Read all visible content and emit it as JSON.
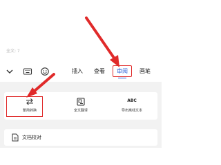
{
  "document": {
    "word_count": "全文: 7"
  },
  "toolbar": {
    "icons": [
      "chevron-down-icon",
      "keyboard-icon",
      "emoji-icon"
    ],
    "tabs": [
      {
        "label": "插入"
      },
      {
        "label": "查看"
      },
      {
        "label": "审阅",
        "active": true
      },
      {
        "label": "画笔"
      }
    ]
  },
  "review_tools": [
    {
      "label": "繁简转换",
      "icon": "convert-arrows-icon",
      "highlighted": true
    },
    {
      "label": "全文翻译",
      "icon": "translate-icon"
    },
    {
      "label": "导出离线文本",
      "icon": "abc-text-icon",
      "icon_text": "ABC"
    }
  ],
  "list": [
    {
      "label": "文档校对",
      "icon": "document-check-icon"
    }
  ],
  "colors": {
    "accent_blue": "#2f62d8",
    "highlight_red": "#e02a2a"
  }
}
